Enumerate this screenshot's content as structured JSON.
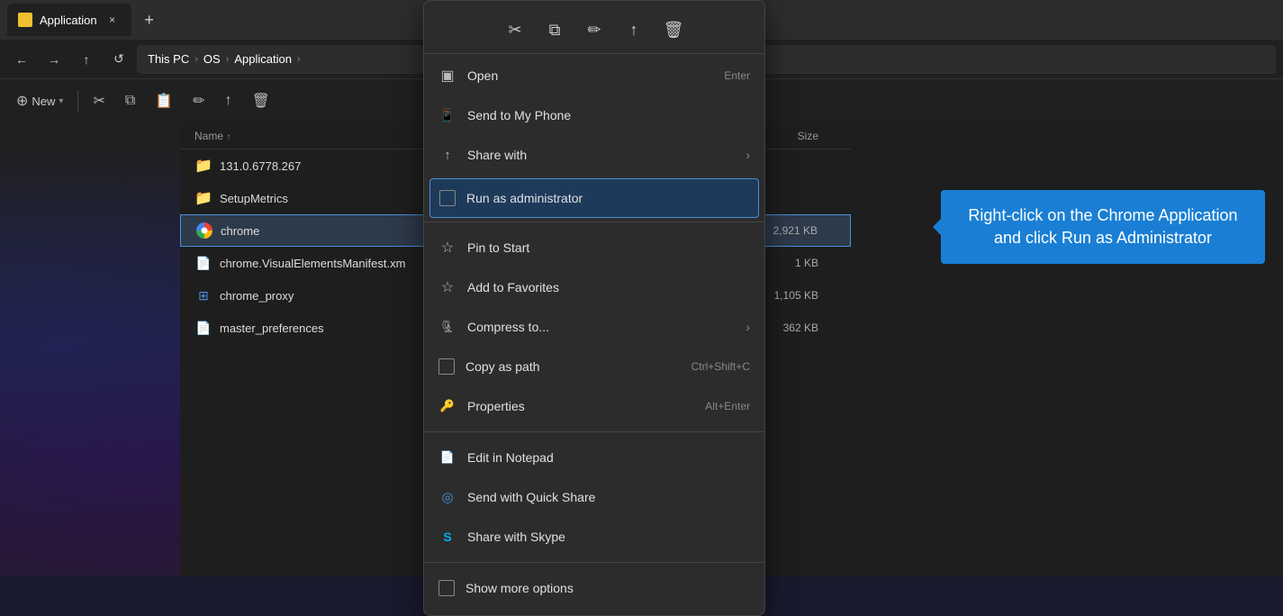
{
  "window": {
    "title": "Application",
    "tab_icon": "folder",
    "close_label": "×",
    "add_tab_label": "+"
  },
  "nav": {
    "back_label": "←",
    "forward_label": "→",
    "up_label": "↑",
    "refresh_label": "↺",
    "breadcrumb": [
      "This PC",
      "OS",
      "Application"
    ]
  },
  "toolbar": {
    "new_label": "New",
    "cut_label": "✂",
    "copy_label": "⧉",
    "paste_label": "⧉",
    "rename_label": "✏",
    "share_label": "↑",
    "delete_label": "🗑"
  },
  "file_list": {
    "col_name": "Name",
    "col_size": "Size",
    "sort_arrow": "↑",
    "items": [
      {
        "name": "131.0.6778.267",
        "type": "folder",
        "size": ""
      },
      {
        "name": "SetupMetrics",
        "type": "folder",
        "size": ""
      },
      {
        "name": "chrome",
        "type": "chrome_exe",
        "size": "2,921 KB",
        "selected": true
      },
      {
        "name": "chrome.VisualElementsManifest.xm",
        "type": "file",
        "size": "1 KB"
      },
      {
        "name": "chrome_proxy",
        "type": "file_grid",
        "size": "1,105 KB"
      },
      {
        "name": "master_preferences",
        "type": "file",
        "size": "362 KB"
      }
    ]
  },
  "callout": {
    "text": "Right-click on the Chrome Application and click Run as Administrator"
  },
  "context_menu": {
    "icon_buttons": [
      {
        "name": "cut-icon",
        "symbol": "✂"
      },
      {
        "name": "copy-icon",
        "symbol": "⧉"
      },
      {
        "name": "rename-icon",
        "symbol": "✏"
      },
      {
        "name": "share-icon",
        "symbol": "↑"
      },
      {
        "name": "delete-icon",
        "symbol": "🗑"
      }
    ],
    "items": [
      {
        "id": "open",
        "icon": "▣",
        "label": "Open",
        "shortcut": "Enter",
        "arrow": "",
        "section": 1
      },
      {
        "id": "send-to-phone",
        "icon": "📱",
        "label": "Send to My Phone",
        "shortcut": "",
        "arrow": "",
        "section": 1
      },
      {
        "id": "share-with",
        "icon": "↑",
        "label": "Share with",
        "shortcut": "",
        "arrow": "›",
        "section": 1
      },
      {
        "id": "run-as-admin",
        "icon": "⬜",
        "label": "Run as administrator",
        "shortcut": "",
        "arrow": "",
        "section": 1,
        "highlighted": true
      },
      {
        "id": "pin-to-start",
        "icon": "☆",
        "label": "Pin to Start",
        "shortcut": "",
        "arrow": "",
        "section": 2
      },
      {
        "id": "add-favorites",
        "icon": "☆",
        "label": "Add to Favorites",
        "shortcut": "",
        "arrow": "",
        "section": 2
      },
      {
        "id": "compress",
        "icon": "🗜",
        "label": "Compress to...",
        "shortcut": "",
        "arrow": "›",
        "section": 2
      },
      {
        "id": "copy-path",
        "icon": "⬜",
        "label": "Copy as path",
        "shortcut": "Ctrl+Shift+C",
        "arrow": "",
        "section": 2
      },
      {
        "id": "properties",
        "icon": "🔑",
        "label": "Properties",
        "shortcut": "Alt+Enter",
        "arrow": "",
        "section": 2
      },
      {
        "id": "edit-notepad",
        "icon": "📄",
        "label": "Edit in Notepad",
        "shortcut": "",
        "arrow": "",
        "section": 3
      },
      {
        "id": "quick-share",
        "icon": "◎",
        "label": "Send with Quick Share",
        "shortcut": "",
        "arrow": "",
        "section": 3
      },
      {
        "id": "skype",
        "icon": "S",
        "label": "Share with Skype",
        "shortcut": "",
        "arrow": "",
        "section": 3
      },
      {
        "id": "more-options",
        "icon": "⬛",
        "label": "Show more options",
        "shortcut": "",
        "arrow": "",
        "section": 4
      }
    ]
  }
}
